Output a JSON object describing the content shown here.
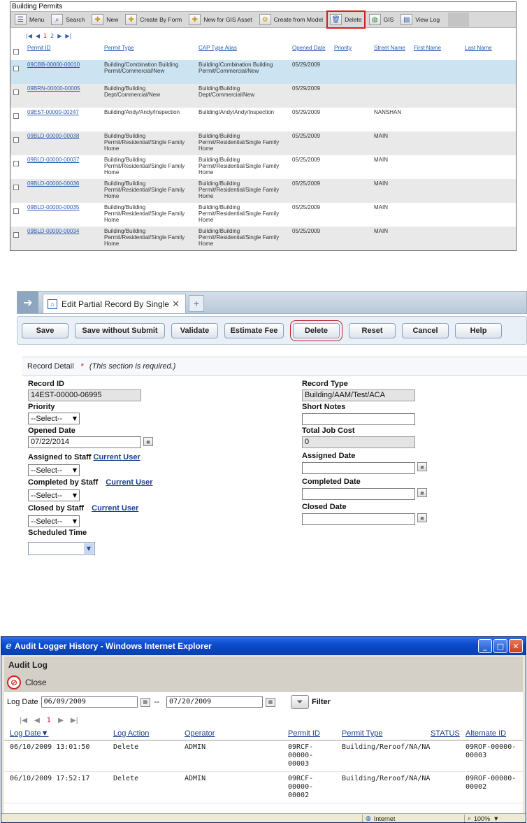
{
  "building_permits": {
    "title": "Building Permits",
    "toolbar": [
      {
        "label": "Menu",
        "icon": "menu-icon",
        "glyph": "☰"
      },
      {
        "label": "Search",
        "icon": "search-icon",
        "glyph": "⌕"
      },
      {
        "label": "New",
        "icon": "new-icon",
        "glyph": "✚"
      },
      {
        "label": "Create By Form",
        "icon": "create-form-icon",
        "glyph": "✚"
      },
      {
        "label": "New for GIS Asset",
        "icon": "gis-asset-icon",
        "glyph": "✚"
      },
      {
        "label": "Create from Model",
        "icon": "model-icon",
        "glyph": "⚙"
      },
      {
        "label": "Delete",
        "icon": "trash-icon",
        "glyph": "🗑",
        "highlighted": true
      },
      {
        "label": "GIS",
        "icon": "globe-icon",
        "glyph": "◍"
      },
      {
        "label": "View Log",
        "icon": "log-icon",
        "glyph": "▤"
      }
    ],
    "pager": {
      "first": "|◀",
      "prev": "◀",
      "pages": [
        "1",
        "2"
      ],
      "next": "▶",
      "last": "▶|"
    },
    "columns": [
      "Permit ID",
      "Permit Type",
      "CAP Type Alias",
      "Opened Date",
      "Priority",
      "Street Name",
      "First Name",
      "Last Name"
    ],
    "rows": [
      {
        "id": "09CBB-00000-00010",
        "type": "Building/Combination Building Permit/Commercial/New",
        "alias": "Building/Combination Building Permit/Commercial/New",
        "opened": "05/29/2009",
        "priority": "",
        "street": "",
        "first": "",
        "last": ""
      },
      {
        "id": "09BRN-00000-00005",
        "type": "Building/Building Dept/Commercial/New",
        "alias": "Building/Building Dept/Commercial/New",
        "opened": "05/29/2009",
        "priority": "",
        "street": "",
        "first": "",
        "last": ""
      },
      {
        "id": "09EST-00000-00247",
        "type": "Building/Andy/Andy/Inspection",
        "alias": "Building/Andy/Andy/Inspection",
        "opened": "05/29/2009",
        "priority": "",
        "street": "NANSHAN",
        "first": "",
        "last": ""
      },
      {
        "id": "09BLD-00000-00038",
        "type": "Building/Building Permit/Residential/Single Family Home",
        "alias": "Building/Building Permit/Residential/Single Family Home",
        "opened": "05/25/2009",
        "priority": "",
        "street": "MAIN",
        "first": "",
        "last": ""
      },
      {
        "id": "09BLD-00000-00037",
        "type": "Building/Building Permit/Residential/Single Family Home",
        "alias": "Building/Building Permit/Residential/Single Family Home",
        "opened": "05/25/2009",
        "priority": "",
        "street": "MAIN",
        "first": "",
        "last": ""
      },
      {
        "id": "09BLD-00000-00036",
        "type": "Building/Building Permit/Residential/Single Family Home",
        "alias": "Building/Building Permit/Residential/Single Family Home",
        "opened": "05/25/2009",
        "priority": "",
        "street": "MAIN",
        "first": "",
        "last": ""
      },
      {
        "id": "09BLD-00000-00035",
        "type": "Building/Building Permit/Residential/Single Family Home",
        "alias": "Building/Building Permit/Residential/Single Family Home",
        "opened": "05/25/2009",
        "priority": "",
        "street": "MAIN",
        "first": "",
        "last": ""
      },
      {
        "id": "09BLD-00000-00034",
        "type": "Building/Building Permit/Residential/Single Family Home",
        "alias": "Building/Building Permit/Residential/Single Family Home",
        "opened": "05/25/2009",
        "priority": "",
        "street": "MAIN",
        "first": "",
        "last": ""
      }
    ]
  },
  "edit_record": {
    "tab_label": "Edit Partial Record By Single",
    "tab_close": "✕",
    "new_tab": "+",
    "buttons": [
      "Save",
      "Save without Submit",
      "Validate",
      "Estimate Fee",
      "Delete",
      "Reset",
      "Cancel",
      "Help"
    ],
    "section_title": "Record Detail",
    "required_star": "*",
    "required_note": "(This section is required.)",
    "fields": {
      "record_id_label": "Record ID",
      "record_id_value": "14EST-00000-06995",
      "priority_label": "Priority",
      "priority_value": "--Select--",
      "opened_label": "Opened Date",
      "opened_value": "07/22/2014",
      "assigned_staff_label": "Assigned to Staff",
      "assigned_staff_link": "Current User",
      "assigned_staff_value": "--Select--",
      "completed_staff_label": "Completed by Staff",
      "completed_staff_link": "Current User",
      "completed_staff_value": "--Select--",
      "closed_staff_label": "Closed by Staff",
      "closed_staff_link": "Current User",
      "closed_staff_value": "--Select--",
      "scheduled_label": "Scheduled Time",
      "scheduled_value": "",
      "record_type_label": "Record Type",
      "record_type_value": "Building/AAM/Test/ACA",
      "short_notes_label": "Short Notes",
      "short_notes_value": "",
      "total_cost_label": "Total Job Cost",
      "total_cost_value": "0",
      "assigned_date_label": "Assigned Date",
      "assigned_date_value": "",
      "completed_date_label": "Completed Date",
      "completed_date_value": "",
      "closed_date_label": "Closed Date",
      "closed_date_value": ""
    }
  },
  "audit_log": {
    "window_title": "Audit Logger History - Windows Internet Explorer",
    "window_buttons": [
      "_",
      "□",
      "✕"
    ],
    "header": "Audit Log",
    "close_label": "Close",
    "log_date_label": "Log Date",
    "date_from": "06/09/2009",
    "date_sep": "--",
    "date_to": "07/20/2009",
    "filter_label": "Filter",
    "pager": {
      "first": "|◀",
      "prev": "◀",
      "current": "1",
      "next": "▶",
      "last": "▶|"
    },
    "columns": [
      "Log Date▼",
      "Log Action",
      "Operator",
      "Permit ID",
      "Permit Type",
      "STATUS",
      "Alternate ID"
    ],
    "rows": [
      {
        "date": "06/10/2009 13:01:50",
        "action": "Delete",
        "operator": "ADMIN",
        "permit": "09RCF-00000-00003",
        "type": "Building/Reroof/NA/NA",
        "status": "",
        "alt": "09ROF-00000-00003"
      },
      {
        "date": "06/10/2009 17:52:17",
        "action": "Delete",
        "operator": "ADMIN",
        "permit": "09RCF-00000-00002",
        "type": "Building/Reroof/NA/NA",
        "status": "",
        "alt": "09ROF-00000-00002"
      }
    ],
    "status_zone": "Internet",
    "status_zoom": "100%"
  }
}
